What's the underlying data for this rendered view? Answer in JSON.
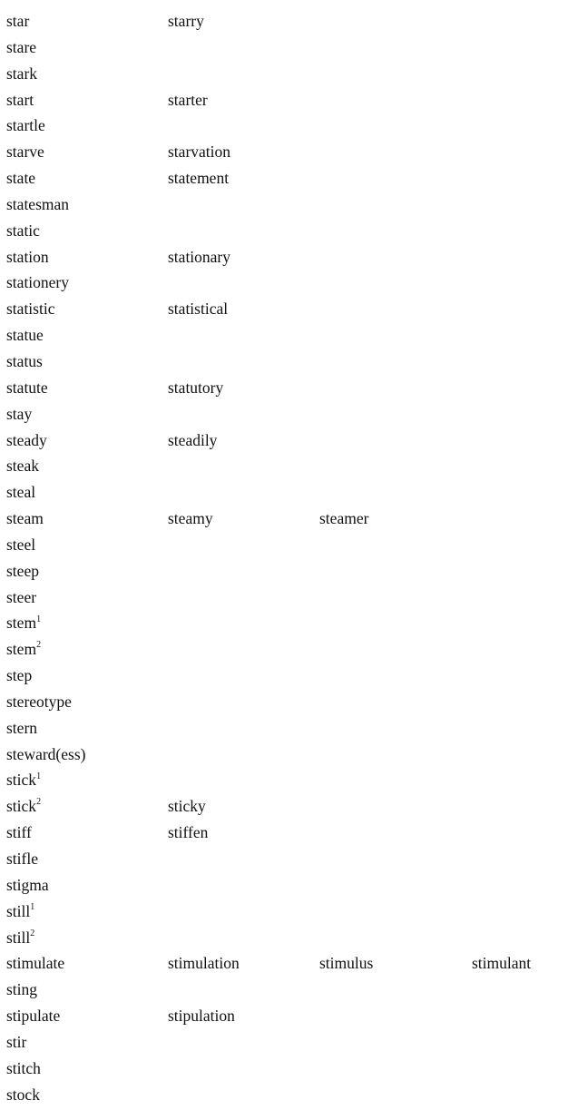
{
  "rows": [
    {
      "headword": "star",
      "derivatives": [
        "starry"
      ]
    },
    {
      "headword": "stare",
      "derivatives": []
    },
    {
      "headword": "stark",
      "derivatives": []
    },
    {
      "headword": "start",
      "derivatives": [
        "starter"
      ]
    },
    {
      "headword": "startle",
      "derivatives": []
    },
    {
      "headword": "starve",
      "derivatives": [
        "starvation"
      ]
    },
    {
      "headword": "state",
      "derivatives": [
        "statement"
      ]
    },
    {
      "headword": "statesman",
      "derivatives": []
    },
    {
      "headword": "static",
      "derivatives": []
    },
    {
      "headword": "station",
      "derivatives": [
        "stationary"
      ]
    },
    {
      "headword": "stationery",
      "derivatives": []
    },
    {
      "headword": "statistic",
      "derivatives": [
        "statistical"
      ]
    },
    {
      "headword": "statue",
      "derivatives": []
    },
    {
      "headword": "status",
      "derivatives": []
    },
    {
      "headword": "statute",
      "derivatives": [
        "statutory"
      ]
    },
    {
      "headword": "stay",
      "derivatives": []
    },
    {
      "headword": "steady",
      "derivatives": [
        "steadily"
      ]
    },
    {
      "headword": "steak",
      "derivatives": []
    },
    {
      "headword": "steal",
      "derivatives": []
    },
    {
      "headword": "steam",
      "derivatives": [
        "steamy",
        "steamer"
      ]
    },
    {
      "headword": "steel",
      "derivatives": []
    },
    {
      "headword": "steep",
      "derivatives": []
    },
    {
      "headword": "steer",
      "derivatives": []
    },
    {
      "headword": "stem",
      "sup": "1",
      "derivatives": []
    },
    {
      "headword": "stem",
      "sup": "2",
      "derivatives": []
    },
    {
      "headword": "step",
      "derivatives": []
    },
    {
      "headword": "stereotype",
      "derivatives": []
    },
    {
      "headword": "stern",
      "derivatives": []
    },
    {
      "headword": "steward(ess)",
      "derivatives": []
    },
    {
      "headword": "stick",
      "sup": "1",
      "derivatives": []
    },
    {
      "headword": "stick",
      "sup": "2",
      "derivatives": [
        "sticky"
      ]
    },
    {
      "headword": "stiff",
      "derivatives": [
        "stiffen"
      ]
    },
    {
      "headword": "stifle",
      "derivatives": []
    },
    {
      "headword": "stigma",
      "derivatives": []
    },
    {
      "headword": "still",
      "sup": "1",
      "derivatives": []
    },
    {
      "headword": "still",
      "sup": "2",
      "derivatives": []
    },
    {
      "headword": "stimulate",
      "derivatives": [
        "stimulation",
        "stimulus",
        "stimulant"
      ]
    },
    {
      "headword": "sting",
      "derivatives": []
    },
    {
      "headword": "stipulate",
      "derivatives": [
        "stipulation"
      ]
    },
    {
      "headword": "stir",
      "derivatives": []
    },
    {
      "headword": "stitch",
      "derivatives": []
    },
    {
      "headword": "stock",
      "derivatives": []
    }
  ]
}
